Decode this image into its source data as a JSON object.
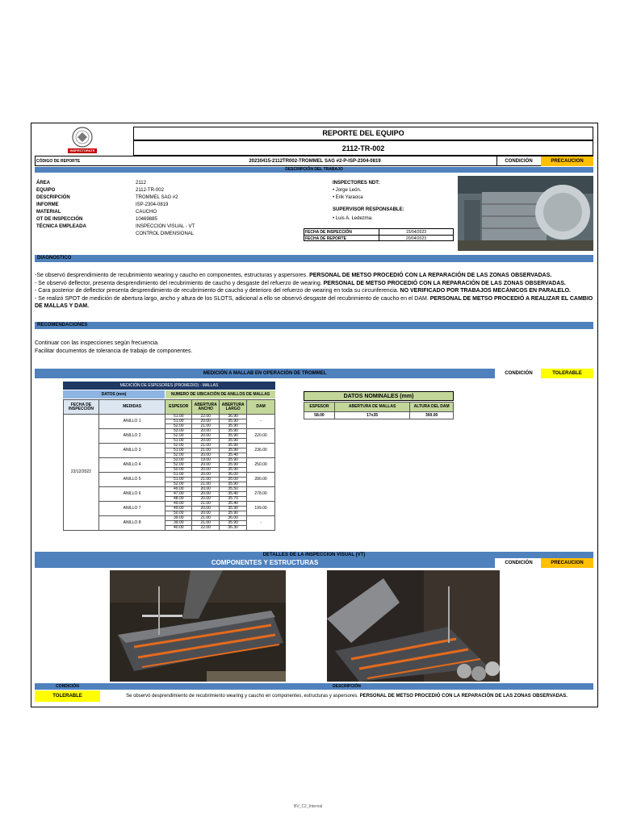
{
  "header": {
    "title": "REPORTE DEL EQUIPO",
    "equipment_code": "2112-TR-002",
    "logo_text": "INSPECTORATE",
    "report_code_label": "CÓDIGO DE REPORTE",
    "report_code": "20230415-2112TR002-TROMMEL SAG #2-P-ISP-2304-0819",
    "condition_label": "CONDICIÓN",
    "condition_value": "PRECAUCION"
  },
  "work": {
    "section_label": "DESCRIPCIÓN DEL TRABAJO",
    "fields": [
      {
        "label": "ÁREA",
        "value": "2112"
      },
      {
        "label": "EQUIPO",
        "value": "2112-TR-002"
      },
      {
        "label": "DESCRIPCIÓN",
        "value": "TROMMEL SAG #2"
      },
      {
        "label": "INFORME",
        "value": "ISP-2304-0819"
      },
      {
        "label": "MATERIAL",
        "value": "CAUCHO"
      },
      {
        "label": "OT DE INSPECCIÓN",
        "value": "10469885"
      },
      {
        "label": "TÉCNICA EMPLEADA",
        "value": "INSPECCION VISUAL - VT"
      },
      {
        "label": "",
        "value": "CONTROL DIMENSIONAL"
      }
    ],
    "inspectors_label": "INSPECTORES NDT:",
    "inspectors": [
      "• Jorge León.",
      "• Erik Yaraoca"
    ],
    "supervisor_label": "SUPERVISOR RESPONSABLE:",
    "supervisor": "• Luis A. Ledezma.",
    "inspection_date_label": "FECHA DE INSPECCIÓN",
    "inspection_date": "15/04/2023",
    "report_date_label": "FECHA DE REPORTE",
    "report_date": "20/04/2023"
  },
  "diagnostico": {
    "title": "DIAGNOSTICO",
    "lines": [
      {
        "normal": "-Se observó desprendimiento de recubrimiento wearing y caucho en componentes, estructuras y aspersores. ",
        "bold": "PERSONAL DE METSO PROCEDIÓ CON LA REPARACIÓN DE LAS ZONAS OBSERVADAS."
      },
      {
        "normal": "- Se observó deflector, presenta desprendimiento del recubrimiento de caucho y desgaste del refuerzo de wearing. ",
        "bold": "PERSONAL DE METSO PROCEDIÓ CON LA REPARACIÓN DE LAS ZONAS OBSERVADAS."
      },
      {
        "normal": "- Cara posterior de deflector presenta desprendimiento de recubrimiento de caucho y deterioro del refuerzo de wearing en toda su circunferencia. ",
        "bold": "NO VERIFICADO POR TRABAJOS MECÁNICOS EN PARALELO."
      },
      {
        "normal": "- Se realizó SPOT de  medición de abertura largo, ancho y altura de los SLOTS, adicional a ello se observó desgaste del recubrimiento de caucho en el DAM. ",
        "bold": "PERSONAL DE METSO PROCEDIÓ A REALIZAR EL CAMBIO DE MALLAS Y DAM."
      }
    ]
  },
  "recomendaciones": {
    "title": "RECOMENDACIONES",
    "lines": [
      "Continuar con las inspecciones según frecuencia.",
      "Facilitar documentos de tolerancia de trabajo de componentes."
    ]
  },
  "mallas": {
    "title": "MEDICIÓN  A MALLAB EN OPERACIÓN DE TROMMEL",
    "condition_label": "CONDICIÓN",
    "condition_value": "TOLERABLE",
    "table_title": "MEDICIÓN DE ESPESORES (PROMEDIO) - MALLAS",
    "datos_label": "DATOS (mm)",
    "ubicacion_label": "NUMERO DE UBICACIÓN DE ANILLOS DE MALLAS",
    "col_fecha": "FECHA DE INSPECCIÓN",
    "col_medidas": "MEDIDAS",
    "col_espesor": "ESPESOR",
    "col_ancho": "ABERTURA ANCHO",
    "col_largo": "ABERTURA LARGO",
    "col_dam": "DAM",
    "fecha": "22/12/2022",
    "rings": [
      {
        "name": "ANILLO 1",
        "dam": "-",
        "rows": [
          [
            "51.00",
            "22.00",
            "36.90"
          ],
          [
            "51.00",
            "20.00",
            "35.90"
          ],
          [
            "52.00",
            "21.00",
            "35.90"
          ]
        ]
      },
      {
        "name": "ANILLO 2",
        "dam": "220.00",
        "rows": [
          [
            "53.00",
            "20.00",
            "35.90"
          ],
          [
            "52.00",
            "20.00",
            "35.90"
          ],
          [
            "51.00",
            "20.00",
            "35.90"
          ]
        ]
      },
      {
        "name": "ANILLO 3",
        "dam": "236.00",
        "rows": [
          [
            "52.00",
            "21.00",
            "35.90"
          ],
          [
            "51.00",
            "21.00",
            "35.90"
          ],
          [
            "52.00",
            "20.00",
            "35.40"
          ]
        ]
      },
      {
        "name": "ANILLO 4",
        "dam": "250.00",
        "rows": [
          [
            "53.00",
            "19.00",
            "35.90"
          ],
          [
            "52.00",
            "20.00",
            "35.90"
          ],
          [
            "50.00",
            "20.00",
            "35.90"
          ]
        ]
      },
      {
        "name": "ANILLO 5",
        "dam": "280.00",
        "rows": [
          [
            "51.00",
            "20.00",
            "36.00"
          ],
          [
            "51.00",
            "21.00",
            "35.00"
          ],
          [
            "52.00",
            "21.00",
            "35.90"
          ]
        ]
      },
      {
        "name": "ANILLO 6",
        "dam": "278.00",
        "rows": [
          [
            "49.00",
            "20.00",
            "35.50"
          ],
          [
            "47.00",
            "20.00",
            "35.40"
          ],
          [
            "48.00",
            "20.00",
            "35.70"
          ]
        ]
      },
      {
        "name": "ANILLO 7",
        "dam": "199.00",
        "rows": [
          [
            "49.00",
            "21.00",
            "35.40"
          ],
          [
            "49.00",
            "20.00",
            "35.90"
          ],
          [
            "50.00",
            "20.00",
            "35.90"
          ]
        ]
      },
      {
        "name": "ANILLO 8",
        "dam": "-",
        "rows": [
          [
            "39.00",
            "21.00",
            "36.00"
          ],
          [
            "39.00",
            "21.00",
            "35.90"
          ],
          [
            "40.00",
            "22.00",
            "36.30"
          ]
        ]
      }
    ],
    "nominal_title": "DATOS NOMINALES (mm)",
    "nominal_headers": [
      "ESPESOR",
      "ABERTURA DE MALLAS",
      "ALTURA DEL DAM"
    ],
    "nominal_values": [
      "58.00",
      "17x35",
      "300.00"
    ]
  },
  "visual": {
    "section_label": "DETALLES DE LA INSPECCION VISUAL (VT)",
    "title": "COMPONENTES Y ESTRUCTURAS",
    "condition_label": "CONDICIÓN",
    "condition_value": "PRECAUCION",
    "footer_condition_label": "CONDICIÓN",
    "footer_description_label": "DESCRIPCIÓN",
    "footer_condition_value": "TOLERABLE",
    "footer_text_normal": "Se observó desprendimiento de recubrimiento wearing y caucho en componentes, estructuras y aspersores. ",
    "footer_text_bold": "PERSONAL DE METSO PROCEDIÓ CON LA REPARACIÓN DE LAS ZONAS OBSERVADAS."
  },
  "footer": {
    "doc_code": "BV_C2_Internal"
  },
  "colors": {
    "bar_blue": "#4f81bd",
    "precaucion": "#ffc000",
    "tolerable": "#ffff00",
    "nominal_green": "#c4d79b",
    "table_header_dark": "#1f3864"
  }
}
